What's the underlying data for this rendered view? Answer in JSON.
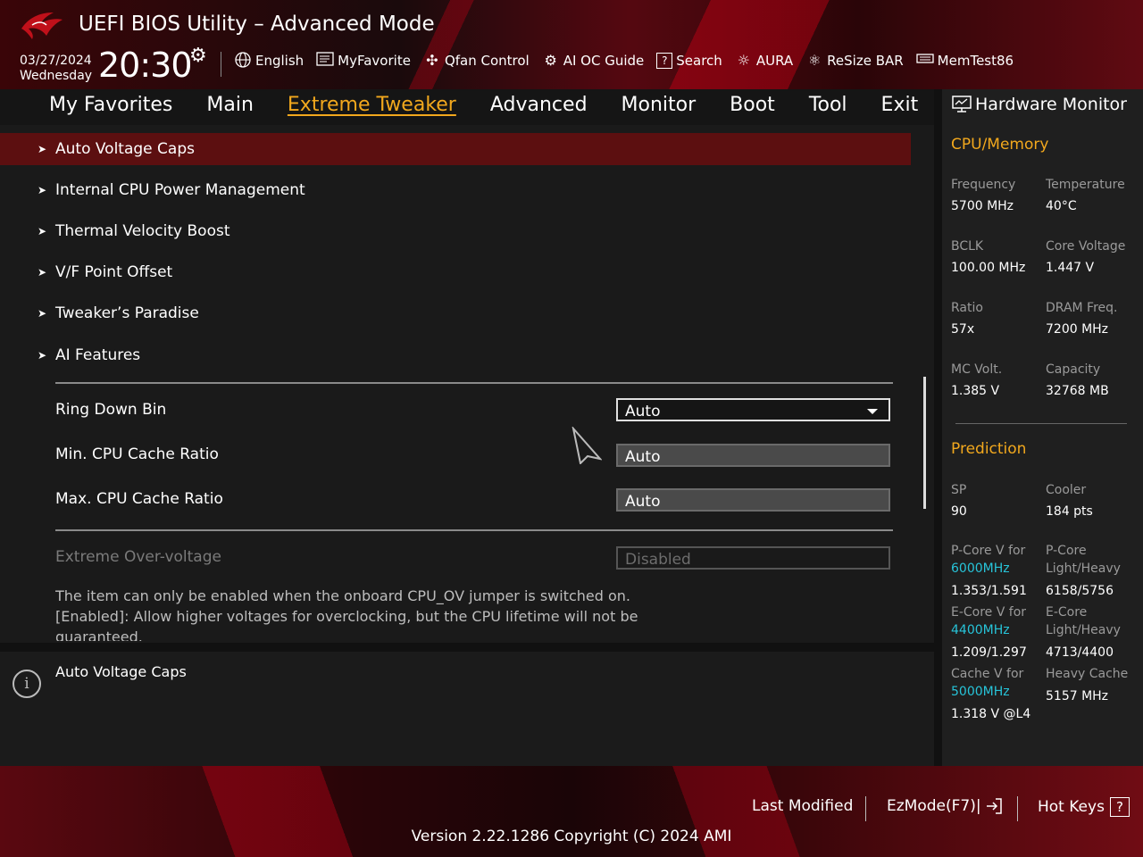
{
  "header": {
    "title": "UEFI BIOS Utility – Advanced Mode",
    "date": "03/27/2024",
    "weekday": "Wednesday",
    "time": "20:30",
    "toolbar": [
      {
        "label": "English",
        "icon": "globe-icon"
      },
      {
        "label": "MyFavorite",
        "icon": "favorite-icon"
      },
      {
        "label": "Qfan Control",
        "icon": "fan-icon"
      },
      {
        "label": "AI OC Guide",
        "icon": "ai-oc-icon"
      },
      {
        "label": "Search",
        "icon": "search-icon"
      },
      {
        "label": "AURA",
        "icon": "aura-icon"
      },
      {
        "label": "ReSize BAR",
        "icon": "resize-bar-icon"
      },
      {
        "label": "MemTest86",
        "icon": "memtest-icon"
      }
    ]
  },
  "nav": {
    "tabs": [
      "My Favorites",
      "Main",
      "Extreme Tweaker",
      "Advanced",
      "Monitor",
      "Boot",
      "Tool",
      "Exit"
    ],
    "active": "Extreme Tweaker"
  },
  "main": {
    "menu_items": [
      "Auto Voltage Caps",
      "Internal CPU Power Management",
      "Thermal Velocity Boost",
      "V/F Point Offset",
      "Tweaker’s Paradise",
      "AI Features"
    ],
    "settings": [
      {
        "label": "Ring Down Bin",
        "value": "Auto",
        "type": "dropdown"
      },
      {
        "label": "Min. CPU Cache Ratio",
        "value": "Auto",
        "type": "input"
      },
      {
        "label": "Max. CPU Cache Ratio",
        "value": "Auto",
        "type": "input"
      },
      {
        "label": "Extreme Over-voltage",
        "value": "Disabled",
        "type": "disabled"
      }
    ],
    "note_line1": "The item can only be enabled when the onboard CPU_OV jumper is switched on.",
    "note_line2": "[Enabled]: Allow higher voltages for overclocking, but the CPU lifetime will not be",
    "note_line3": "guaranteed."
  },
  "info": {
    "text": "Auto Voltage Caps"
  },
  "hw_monitor": {
    "title": "Hardware Monitor",
    "cpu_memory": {
      "section": "CPU/Memory",
      "frequency": {
        "label": "Frequency",
        "value": "5700 MHz"
      },
      "temperature": {
        "label": "Temperature",
        "value": "40°C"
      },
      "bclk": {
        "label": "BCLK",
        "value": "100.00 MHz"
      },
      "core_voltage": {
        "label": "Core Voltage",
        "value": "1.447 V"
      },
      "ratio": {
        "label": "Ratio",
        "value": "57x"
      },
      "dram_freq": {
        "label": "DRAM Freq.",
        "value": "7200 MHz"
      },
      "mc_volt": {
        "label": "MC Volt.",
        "value": "1.385 V"
      },
      "capacity": {
        "label": "Capacity",
        "value": "32768 MB"
      }
    },
    "prediction": {
      "section": "Prediction",
      "sp": {
        "label": "SP",
        "value": "90"
      },
      "cooler": {
        "label": "Cooler",
        "value": "184 pts"
      },
      "pcore_v": {
        "label": "P-Core V for",
        "freq": "6000MHz",
        "value": "1.353/1.591"
      },
      "pcore_lh": {
        "label1": "P-Core",
        "label2": "Light/Heavy",
        "value": "6158/5756"
      },
      "ecore_v": {
        "label": "E-Core V for",
        "freq": "4400MHz",
        "value": "1.209/1.297"
      },
      "ecore_lh": {
        "label1": "E-Core",
        "label2": "Light/Heavy",
        "value": "4713/4400"
      },
      "cache_v": {
        "label": "Cache V for",
        "freq": "5000MHz",
        "value": "1.318 V @L4"
      },
      "heavy_cache": {
        "label": "Heavy Cache",
        "value": "5157 MHz"
      }
    }
  },
  "footer": {
    "last_modified": "Last Modified",
    "ezmode": "EzMode(F7)|",
    "hotkeys": "Hot Keys",
    "hotkeys_icon": "?",
    "version": "Version 2.22.1286 Copyright (C) 2024 AMI"
  },
  "colors": {
    "accent": "#f2a81d",
    "selection": "#5c0f10",
    "cyan": "#27c4d9"
  }
}
